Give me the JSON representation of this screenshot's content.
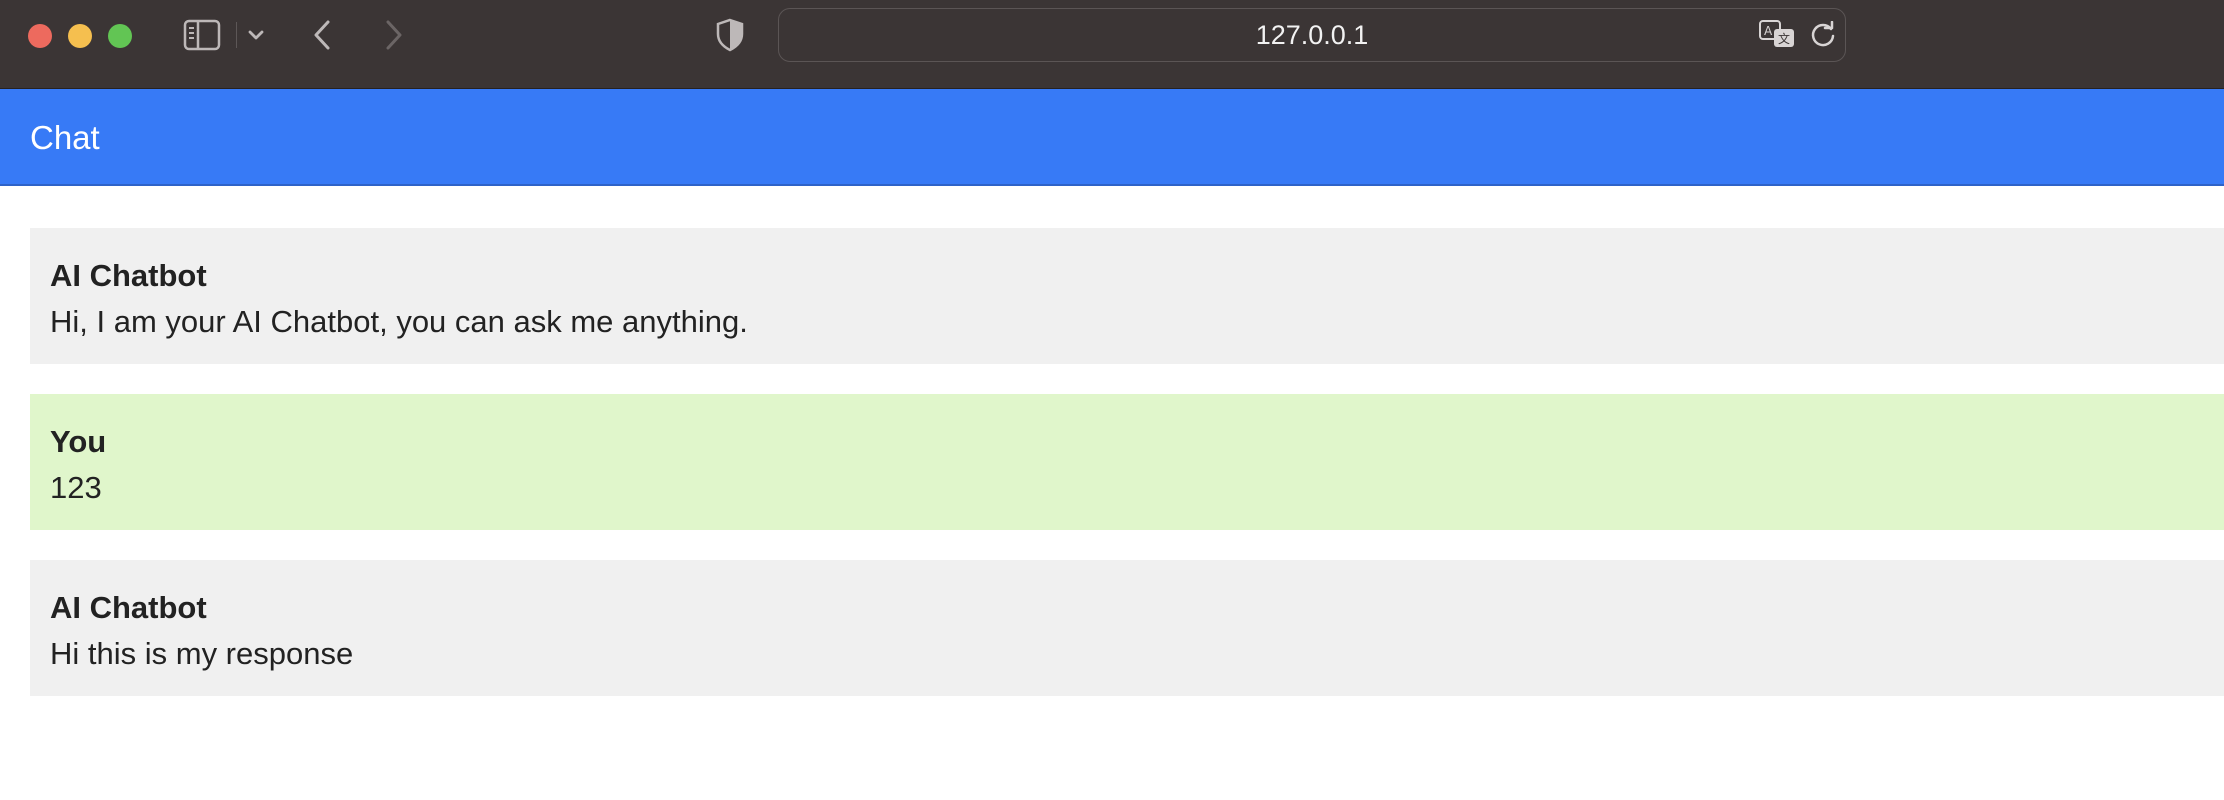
{
  "browser": {
    "url": "127.0.0.1",
    "icons": {
      "sidebar": "sidebar-icon",
      "chevron": "chevron-down-icon",
      "back": "back-icon",
      "forward": "forward-icon",
      "privacy": "shield-icon",
      "translate": "translate-icon",
      "reload": "reload-icon"
    }
  },
  "header": {
    "title": "Chat",
    "color": "#377af6"
  },
  "messages": [
    {
      "sender": "AI Chatbot",
      "text": "Hi, I am your AI Chatbot, you can ask me anything.",
      "role": "bot"
    },
    {
      "sender": "You",
      "text": "123",
      "role": "user"
    },
    {
      "sender": "AI Chatbot",
      "text": "Hi this is my response",
      "role": "bot"
    }
  ],
  "colors": {
    "bot_bubble": "#f0f0f0",
    "user_bubble": "#e0f6cb"
  }
}
